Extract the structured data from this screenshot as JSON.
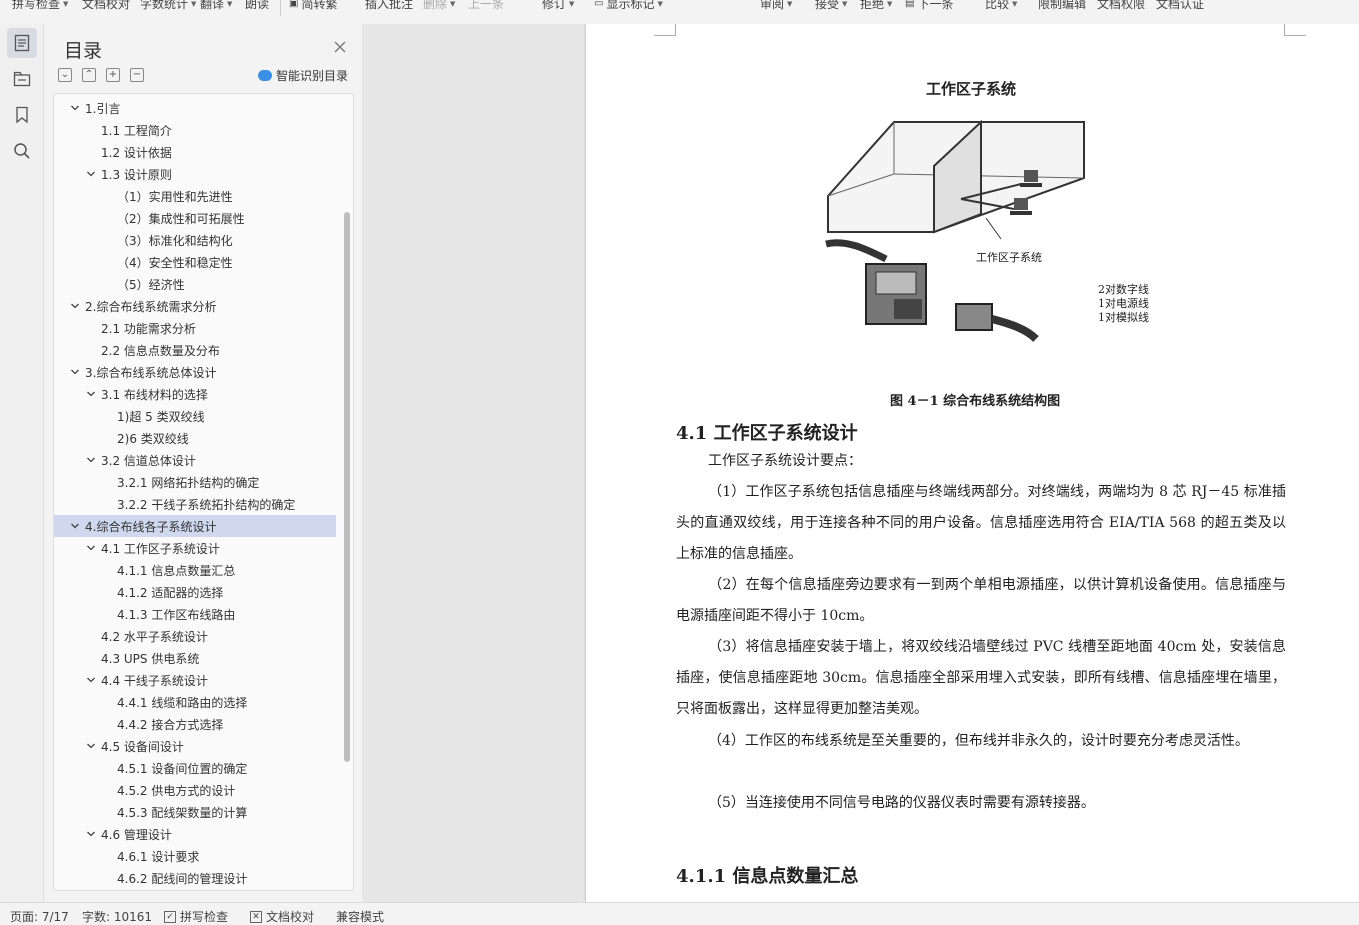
{
  "toolbar": {
    "items": [
      "拼写检查",
      "文档校对",
      "字数统计",
      "翻译",
      "朗读",
      "简转繁",
      "插入批注",
      "删除",
      "上一条",
      "下一条",
      "修订",
      "显示标记",
      "审阅",
      "接受",
      "拒绝",
      "下一条",
      "比较",
      "限制编辑",
      "文档权限",
      "文档认证"
    ]
  },
  "toc": {
    "title": "目录",
    "smart_label": "智能识别目录",
    "items": [
      {
        "text": "1.引言",
        "level": 0,
        "expanded": true
      },
      {
        "text": "1.1 工程简介",
        "level": 1
      },
      {
        "text": "1.2 设计依据",
        "level": 1
      },
      {
        "text": "1.3 设计原则",
        "level": 1,
        "expanded": true
      },
      {
        "text": "（1）实用性和先进性",
        "level": 2
      },
      {
        "text": "（2）集成性和可拓展性",
        "level": 2
      },
      {
        "text": "（3）标准化和结构化",
        "level": 2
      },
      {
        "text": "（4）安全性和稳定性",
        "level": 2
      },
      {
        "text": "（5）经济性",
        "level": 2
      },
      {
        "text": "2.综合布线系统需求分析",
        "level": 0,
        "expanded": true
      },
      {
        "text": "2.1 功能需求分析",
        "level": 1
      },
      {
        "text": "2.2 信息点数量及分布",
        "level": 1
      },
      {
        "text": "3.综合布线系统总体设计",
        "level": 0,
        "expanded": true
      },
      {
        "text": "3.1 布线材料的选择",
        "level": 1,
        "expanded": true
      },
      {
        "text": "1)超 5 类双绞线",
        "level": 2
      },
      {
        "text": "2)6 类双绞线",
        "level": 2
      },
      {
        "text": "3.2 信道总体设计",
        "level": 1,
        "expanded": true
      },
      {
        "text": "3.2.1 网络拓扑结构的确定",
        "level": 2
      },
      {
        "text": "3.2.2 干线子系统拓扑结构的确定",
        "level": 2
      },
      {
        "text": "4.综合布线各子系统设计",
        "level": 0,
        "expanded": true,
        "selected": true
      },
      {
        "text": "4.1 工作区子系统设计",
        "level": 1,
        "expanded": true
      },
      {
        "text": "4.1.1 信息点数量汇总",
        "level": 2
      },
      {
        "text": "4.1.2 适配器的选择",
        "level": 2
      },
      {
        "text": "4.1.3 工作区布线路由",
        "level": 2
      },
      {
        "text": "4.2 水平子系统设计",
        "level": 1
      },
      {
        "text": "4.3 UPS 供电系统",
        "level": 1
      },
      {
        "text": "4.4 干线子系统设计",
        "level": 1,
        "expanded": true
      },
      {
        "text": "4.4.1 线缆和路由的选择",
        "level": 2
      },
      {
        "text": "4.4.2 接合方式选择",
        "level": 2
      },
      {
        "text": "4.5 设备间设计",
        "level": 1,
        "expanded": true
      },
      {
        "text": "4.5.1 设备间位置的确定",
        "level": 2
      },
      {
        "text": "4.5.2 供电方式的设计",
        "level": 2
      },
      {
        "text": "4.5.3 配线架数量的计算",
        "level": 2
      },
      {
        "text": "4.6 管理设计",
        "level": 1,
        "expanded": true
      },
      {
        "text": "4.6.1 设计要求",
        "level": 2
      },
      {
        "text": "4.6.2 配线间的管理设计",
        "level": 2
      }
    ]
  },
  "doc": {
    "figure_title": "工作区子系统",
    "figure_label": "工作区子系统",
    "figure_legend": [
      "2对数字线",
      "1对电源线",
      "1对模拟线"
    ],
    "figure_caption": "图 4－1  综合布线系统结构图",
    "heading": "4.1 工作区子系统设计",
    "intro": "工作区子系统设计要点：",
    "paragraphs": [
      "（1）工作区子系统包括信息插座与终端线两部分。对终端线，两端均为 8 芯 RJ－45 标准插头的直通双绞线，用于连接各种不同的用户设备。信息插座选用符合 EIA/TIA 568 的超五类及以上标准的信息插座。",
      "（2）在每个信息插座旁边要求有一到两个单相电源插座，以供计算机设备使用。信息插座与电源插座间距不得小于 10cm。",
      "（3）将信息插座安装于墙上，将双绞线沿墙壁线过 PVC 线槽至距地面 40cm 处，安装信息插座，使信息插座距地 30cm。信息插座全部采用埋入式安装，即所有线槽、信息插座埋在墙里，只将面板露出，这样显得更加整洁美观。",
      "（4）工作区的布线系统是至关重要的，但布线并非永久的，设计时要充分考虑灵活性。",
      "（5）当连接使用不同信号电路的仪器仪表时需要有源转接器。"
    ],
    "subheading": "4.1.1 信息点数量汇总"
  },
  "status": {
    "page": "页面: 7/17",
    "words": "字数: 10161",
    "spell": "拼写检查",
    "proof": "文档校对",
    "compat": "兼容模式"
  }
}
